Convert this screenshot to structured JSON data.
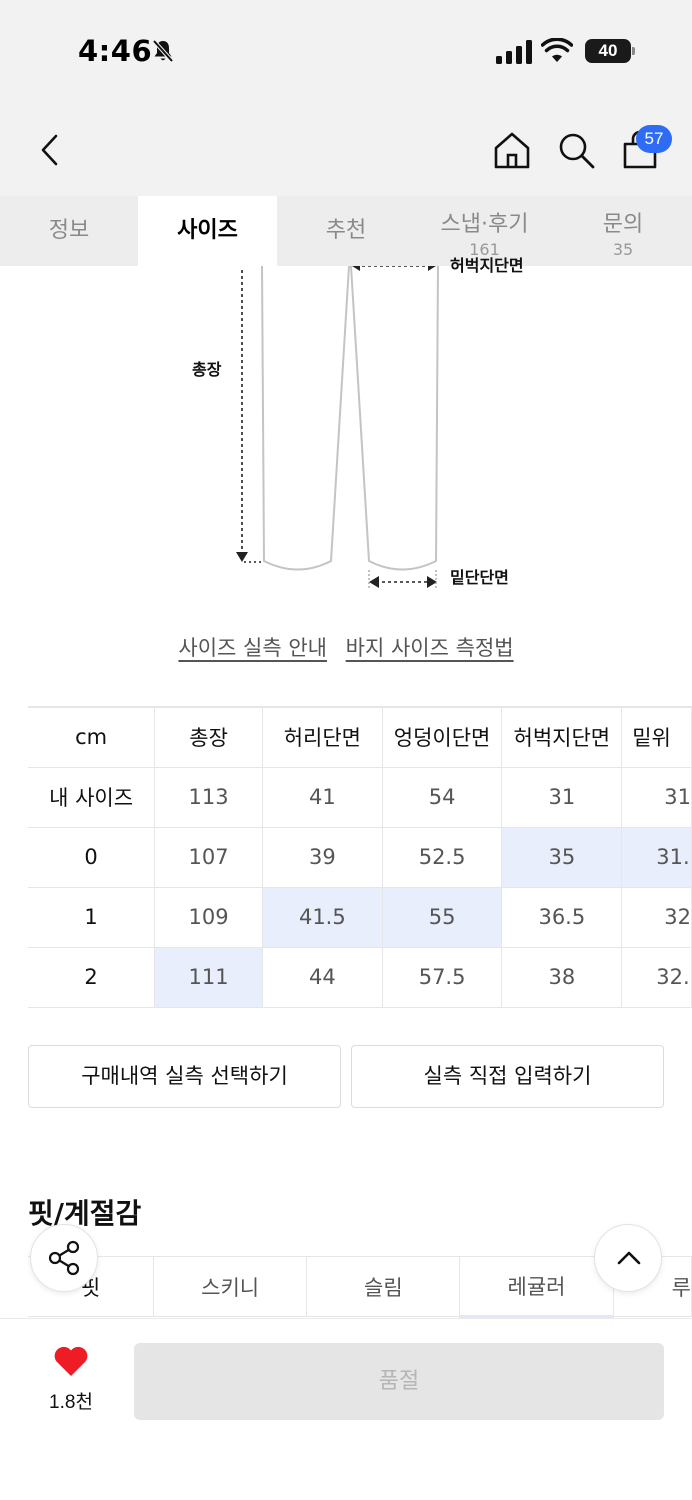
{
  "status_bar": {
    "time": "4:46",
    "battery": "40"
  },
  "header": {
    "cart_count": "57"
  },
  "tabs": [
    {
      "label": "정보",
      "count": ""
    },
    {
      "label": "사이즈",
      "count": ""
    },
    {
      "label": "추천",
      "count": ""
    },
    {
      "label": "스냅·후기",
      "count": "161"
    },
    {
      "label": "문의",
      "count": "35"
    }
  ],
  "diagram": {
    "label_total": "총장",
    "label_thigh": "허벅지단면",
    "label_hem": "밑단단면"
  },
  "links": {
    "guide": "사이즈 실측 안내",
    "measure": "바지 사이즈 측정법"
  },
  "size_table": {
    "headers": [
      "cm",
      "총장",
      "허리단면",
      "엉덩이단면",
      "허벅지단면",
      "밑위"
    ],
    "rows": [
      {
        "label": "내 사이즈",
        "values": [
          "113",
          "41",
          "54",
          "31",
          "31"
        ]
      },
      {
        "label": "0",
        "values": [
          "107",
          "39",
          "52.5",
          "35",
          "31."
        ]
      },
      {
        "label": "1",
        "values": [
          "109",
          "41.5",
          "55",
          "36.5",
          "32"
        ]
      },
      {
        "label": "2",
        "values": [
          "111",
          "44",
          "57.5",
          "38",
          "32."
        ]
      }
    ]
  },
  "buttons": {
    "purchase_history": "구매내역 실측 선택하기",
    "direct_input": "실측 직접 입력하기"
  },
  "fit": {
    "title": "핏/계절감",
    "row_label": "핏",
    "options": [
      "스키니",
      "슬림",
      "레귤러",
      "루"
    ]
  },
  "bottom": {
    "like_count": "1.8천",
    "buy_label": "품절"
  },
  "colors": {
    "accent": "#2f6cf5",
    "highlight": "#e8eefc",
    "like": "#ee1c25"
  }
}
